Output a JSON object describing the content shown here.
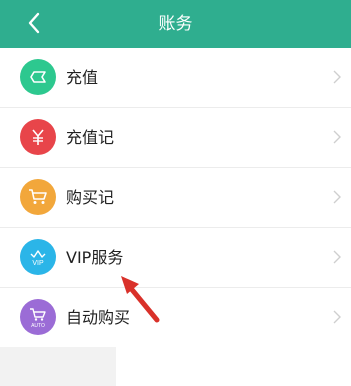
{
  "header": {
    "title": "账务"
  },
  "items": [
    {
      "label": "充值",
      "icon": "recharge-icon",
      "color": "#2dc88f"
    },
    {
      "label": "充值记",
      "icon": "yuan-icon",
      "color": "#e8454a"
    },
    {
      "label": "购买记",
      "icon": "cart-icon",
      "color": "#f2a73b"
    },
    {
      "label": "VIP服务",
      "icon": "vip-crown-icon",
      "color": "#2bb5e8"
    },
    {
      "label": "自动购买",
      "icon": "auto-cart-icon",
      "color": "#9b6cd6"
    }
  ],
  "colors": {
    "header_bg": "#2fae8f",
    "arrow": "#d9312a"
  }
}
